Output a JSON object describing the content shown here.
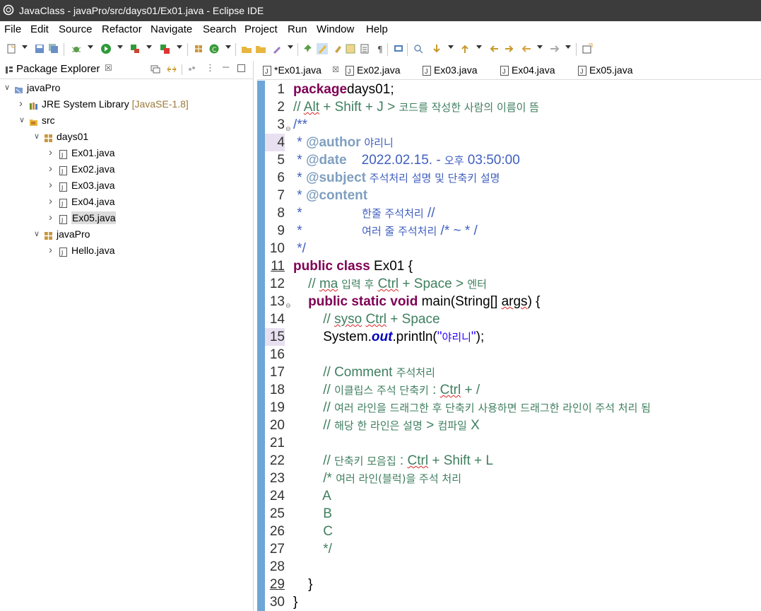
{
  "window": {
    "title": "JavaClass - javaPro/src/days01/Ex01.java - Eclipse IDE"
  },
  "menu": [
    "File",
    "Edit",
    "Source",
    "Refactor",
    "Navigate",
    "Search",
    "Project",
    "Run",
    "Window",
    "Help"
  ],
  "explorer": {
    "title": "Package Explorer",
    "close": "☒",
    "tree": [
      {
        "label": "javaPro",
        "suffix": "",
        "depth": 0,
        "twisty": "open",
        "icon": "project-icon"
      },
      {
        "label": "JRE System Library",
        "suffix": "[JavaSE-1.8]",
        "depth": 1,
        "twisty": "closed",
        "icon": "library-icon"
      },
      {
        "label": "src",
        "suffix": "",
        "depth": 1,
        "twisty": "open",
        "icon": "source-folder-icon"
      },
      {
        "label": "days01",
        "suffix": "",
        "depth": 2,
        "twisty": "open",
        "icon": "package-icon"
      },
      {
        "label": "Ex01.java",
        "suffix": "",
        "depth": 3,
        "twisty": "closed",
        "icon": "java-file-icon"
      },
      {
        "label": "Ex02.java",
        "suffix": "",
        "depth": 3,
        "twisty": "closed",
        "icon": "java-file-icon"
      },
      {
        "label": "Ex03.java",
        "suffix": "",
        "depth": 3,
        "twisty": "closed",
        "icon": "java-file-icon"
      },
      {
        "label": "Ex04.java",
        "suffix": "",
        "depth": 3,
        "twisty": "closed",
        "icon": "java-file-icon"
      },
      {
        "label": "Ex05.java",
        "suffix": "",
        "depth": 3,
        "twisty": "closed",
        "icon": "java-file-icon",
        "selected": true
      },
      {
        "label": "javaPro",
        "suffix": "",
        "depth": 2,
        "twisty": "open",
        "icon": "package-icon"
      },
      {
        "label": "Hello.java",
        "suffix": "",
        "depth": 3,
        "twisty": "closed",
        "icon": "java-file-icon"
      }
    ]
  },
  "editor": {
    "tabs": [
      {
        "label": "*Ex01.java",
        "active": true,
        "close": "☒"
      },
      {
        "label": "Ex02.java"
      },
      {
        "label": "Ex03.java"
      },
      {
        "label": "Ex04.java"
      },
      {
        "label": "Ex05.java"
      }
    ],
    "lines": [
      {
        "n": "1",
        "parts": [
          [
            "kw",
            "package"
          ],
          [
            "",
            "days01;"
          ]
        ]
      },
      {
        "n": "2",
        "parts": [
          [
            "cm",
            "// "
          ],
          [
            "cm sq",
            "Alt"
          ],
          [
            "cm",
            " + Shift + J > "
          ],
          [
            "cm ko",
            "코드를 작성한 사람의 이름이 뜸"
          ]
        ]
      },
      {
        "n": "3",
        "fold": "⊖",
        "parts": [
          [
            "jd",
            "/**"
          ]
        ]
      },
      {
        "n": "4",
        "hl": true,
        "parts": [
          [
            "jd",
            " * "
          ],
          [
            "jt",
            "@author"
          ],
          [
            "jd ko",
            " 야리니"
          ]
        ]
      },
      {
        "n": "5",
        "parts": [
          [
            "jd",
            " * "
          ],
          [
            "jt",
            "@date"
          ],
          [
            "jd",
            "    2022.02.15. - "
          ],
          [
            "jd ko",
            "오후"
          ],
          [
            "jd",
            " 03:50:00"
          ]
        ]
      },
      {
        "n": "6",
        "parts": [
          [
            "jd",
            " * "
          ],
          [
            "jt",
            "@subject"
          ],
          [
            "jd ko",
            " 주석처리 설명 및 단축키 설명"
          ]
        ]
      },
      {
        "n": "7",
        "parts": [
          [
            "jd",
            " * "
          ],
          [
            "jt",
            "@content"
          ]
        ]
      },
      {
        "n": "8",
        "parts": [
          [
            "jd",
            " *                "
          ],
          [
            "jd ko",
            "한줄 주석처리"
          ],
          [
            "jd",
            " //"
          ]
        ]
      },
      {
        "n": "9",
        "parts": [
          [
            "jd",
            " *                "
          ],
          [
            "jd ko",
            "여러 줄 주석처리"
          ],
          [
            "jd",
            " /* ~ * /"
          ]
        ]
      },
      {
        "n": "10",
        "parts": [
          [
            "jd",
            " */"
          ]
        ]
      },
      {
        "n": "11",
        "ul": true,
        "parts": [
          [
            "kw",
            "public class"
          ],
          [
            "",
            " Ex01 {"
          ]
        ]
      },
      {
        "n": "12",
        "parts": [
          [
            "cm",
            "    // "
          ],
          [
            "cm sq",
            "ma"
          ],
          [
            "cm ko",
            " 입력 후"
          ],
          [
            "cm",
            " "
          ],
          [
            "cm sq",
            "Ctrl"
          ],
          [
            "cm",
            " + Space > "
          ],
          [
            "cm ko",
            "엔터"
          ]
        ]
      },
      {
        "n": "13",
        "fold": "⊖",
        "parts": [
          [
            "",
            "    "
          ],
          [
            "kw",
            "public static void"
          ],
          [
            "",
            " main(String[] "
          ],
          [
            "sq",
            "args"
          ],
          [
            "",
            ") {"
          ]
        ]
      },
      {
        "n": "14",
        "parts": [
          [
            "cm",
            "        // "
          ],
          [
            "cm sq",
            "syso"
          ],
          [
            "cm",
            " "
          ],
          [
            "cm sq",
            "Ctrl"
          ],
          [
            "cm",
            " + Space"
          ]
        ]
      },
      {
        "n": "15",
        "hl": true,
        "parts": [
          [
            "",
            "        System."
          ],
          [
            "fld",
            "out"
          ],
          [
            "",
            ".println("
          ],
          [
            "st",
            "\""
          ],
          [
            "st ko",
            "야리니"
          ],
          [
            "st",
            "\""
          ],
          [
            "",
            ");"
          ]
        ]
      },
      {
        "n": "16",
        "parts": []
      },
      {
        "n": "17",
        "parts": [
          [
            "cm",
            "        // Comment "
          ],
          [
            "cm ko",
            "주석처리"
          ]
        ]
      },
      {
        "n": "18",
        "parts": [
          [
            "cm",
            "        // "
          ],
          [
            "cm ko",
            "이클립스 주석 단축키"
          ],
          [
            "cm",
            " : "
          ],
          [
            "cm sq",
            "Ctrl"
          ],
          [
            "cm",
            " + /"
          ]
        ]
      },
      {
        "n": "19",
        "parts": [
          [
            "cm",
            "        // "
          ],
          [
            "cm ko",
            "여러 라인을 드래그한 후 단축키 사용하면 드래그한 라인이 주석 처리 됨"
          ]
        ]
      },
      {
        "n": "20",
        "parts": [
          [
            "cm",
            "        // "
          ],
          [
            "cm ko",
            "해당 한 라인은 설명"
          ],
          [
            "cm",
            " > "
          ],
          [
            "cm ko",
            "컴파일"
          ],
          [
            "cm",
            " X"
          ]
        ]
      },
      {
        "n": "21",
        "parts": []
      },
      {
        "n": "22",
        "parts": [
          [
            "cm",
            "        // "
          ],
          [
            "cm ko",
            "단축키 모음집"
          ],
          [
            "cm",
            " : "
          ],
          [
            "cm sq",
            "Ctrl"
          ],
          [
            "cm",
            " + Shift + L"
          ]
        ]
      },
      {
        "n": "23",
        "parts": [
          [
            "cm",
            "        /* "
          ],
          [
            "cm ko",
            "여러 라인(블럭)을 주석 처리"
          ]
        ]
      },
      {
        "n": "24",
        "parts": [
          [
            "cm",
            "        A"
          ]
        ]
      },
      {
        "n": "25",
        "parts": [
          [
            "cm",
            "        B"
          ]
        ]
      },
      {
        "n": "26",
        "parts": [
          [
            "cm",
            "        C"
          ]
        ]
      },
      {
        "n": "27",
        "parts": [
          [
            "cm",
            "        */"
          ]
        ]
      },
      {
        "n": "28",
        "parts": []
      },
      {
        "n": "29",
        "ul": true,
        "parts": [
          [
            "",
            "    }"
          ]
        ]
      },
      {
        "n": "30",
        "parts": [
          [
            "",
            "}"
          ]
        ]
      }
    ]
  },
  "colors": {
    "titlebar": "#3c3c3c",
    "gutter": "#6ea6d8",
    "keyword": "#7f0055",
    "comment": "#3f7f5f",
    "javadoc": "#3f5fbf"
  }
}
